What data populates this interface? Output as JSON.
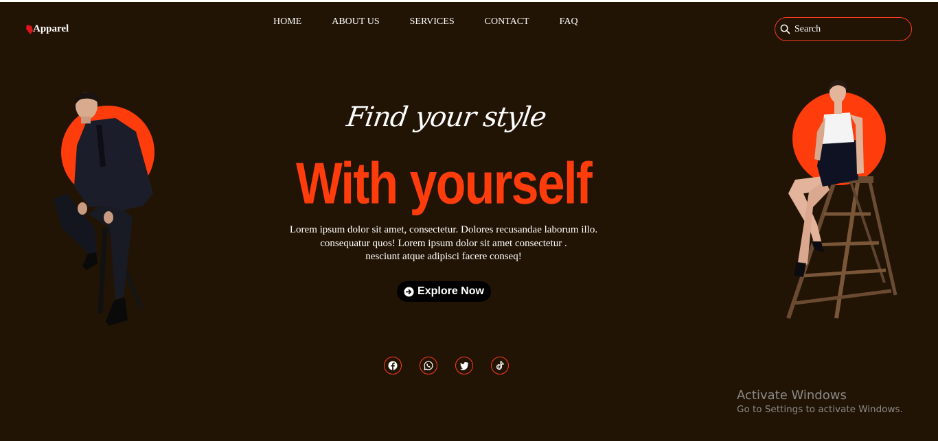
{
  "brand": {
    "name": "Apparel",
    "icon": "pin-icon",
    "accent": "#ff3c0c"
  },
  "nav": {
    "items": [
      "HOME",
      "ABOUT US",
      "SERVICES",
      "CONTACT",
      "FAQ"
    ]
  },
  "search": {
    "placeholder": "Search"
  },
  "hero": {
    "script_title": "Find your style",
    "title": "With yourself",
    "description_lines": [
      "Lorem ipsum dolor sit amet, consectetur. Dolores recusandae laborum illo.",
      "consequatur quos! Lorem ipsum dolor sit amet consectetur .",
      "nesciunt atque adipisci facere conseq!"
    ],
    "cta": {
      "label": "Explore Now",
      "icon": "arrow-circle-icon"
    }
  },
  "socials": [
    "facebook-icon",
    "whatsapp-icon",
    "twitter-icon",
    "tiktok-icon"
  ],
  "watermark": {
    "title": "Activate Windows",
    "subtitle": "Go to Settings to activate Windows."
  },
  "colors": {
    "background": "#221404",
    "accent": "#ff3c0c",
    "button": "#000000"
  }
}
